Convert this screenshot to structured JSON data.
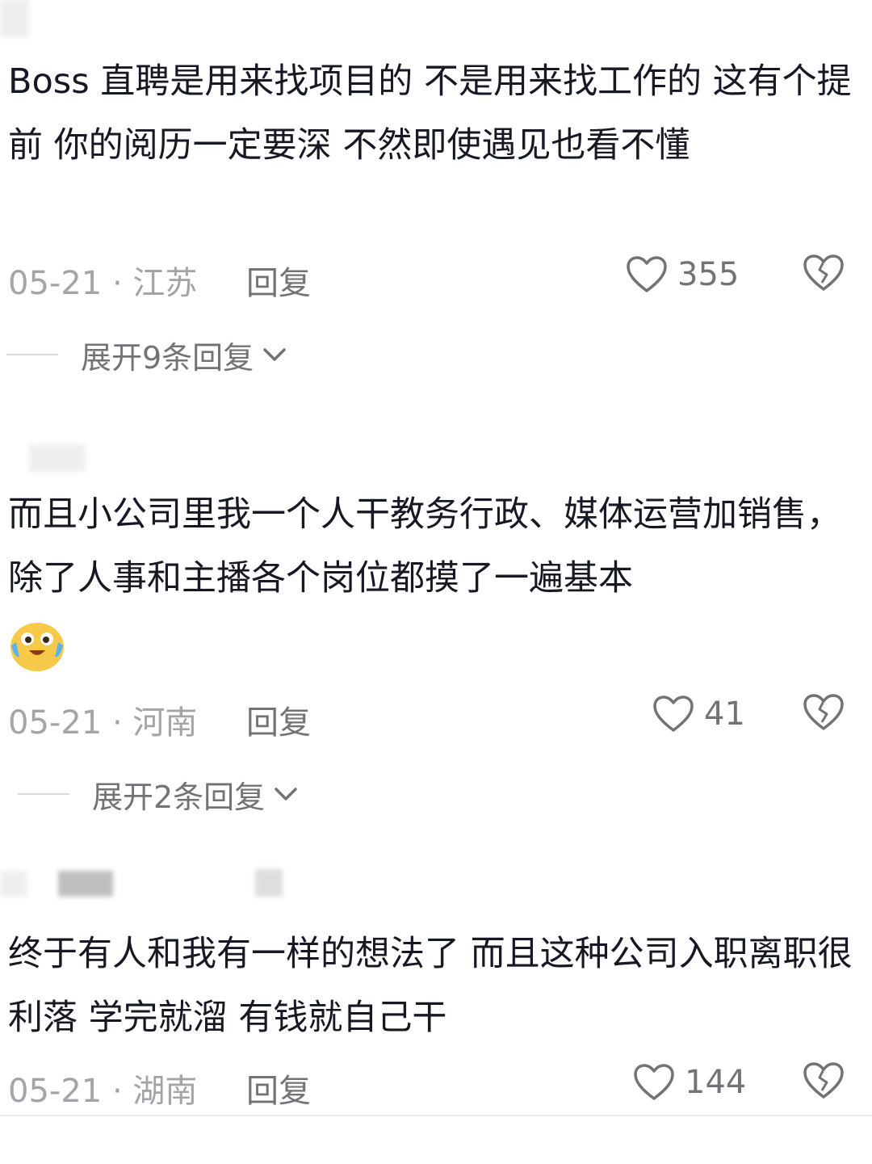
{
  "comments": [
    {
      "text": "Boss 直聘是用来找项目的 不是用来找工作的 这有个提前 你的阅历一定要深 不然即使遇见也看不懂",
      "date_location": "05-21 · 江苏",
      "reply_label": "回复",
      "like_count": "355",
      "expand_label": "展开9条回复"
    },
    {
      "text": "而且小公司里我一个人干教务行政、媒体运营加销售，除了人事和主播各个岗位都摸了一遍基本",
      "date_location": "05-21 · 河南",
      "reply_label": "回复",
      "like_count": "41",
      "expand_label": "展开2条回复"
    },
    {
      "text": "终于有人和我有一样的想法了 而且这种公司入职离职很利落 学完就溜 有钱就自己干",
      "date_location": "05-21 · 湖南",
      "reply_label": "回复",
      "like_count": "144"
    }
  ],
  "icons": {
    "like": "heart-outline-icon",
    "dislike": "broken-heart-icon",
    "expand": "chevron-down-icon",
    "emoji": "crying-laughing-emoji-icon"
  },
  "colors": {
    "text_primary": "#161823",
    "text_meta": "#a3a4a8",
    "text_secondary": "#727377",
    "emoji_yellow": "#f7c948"
  }
}
